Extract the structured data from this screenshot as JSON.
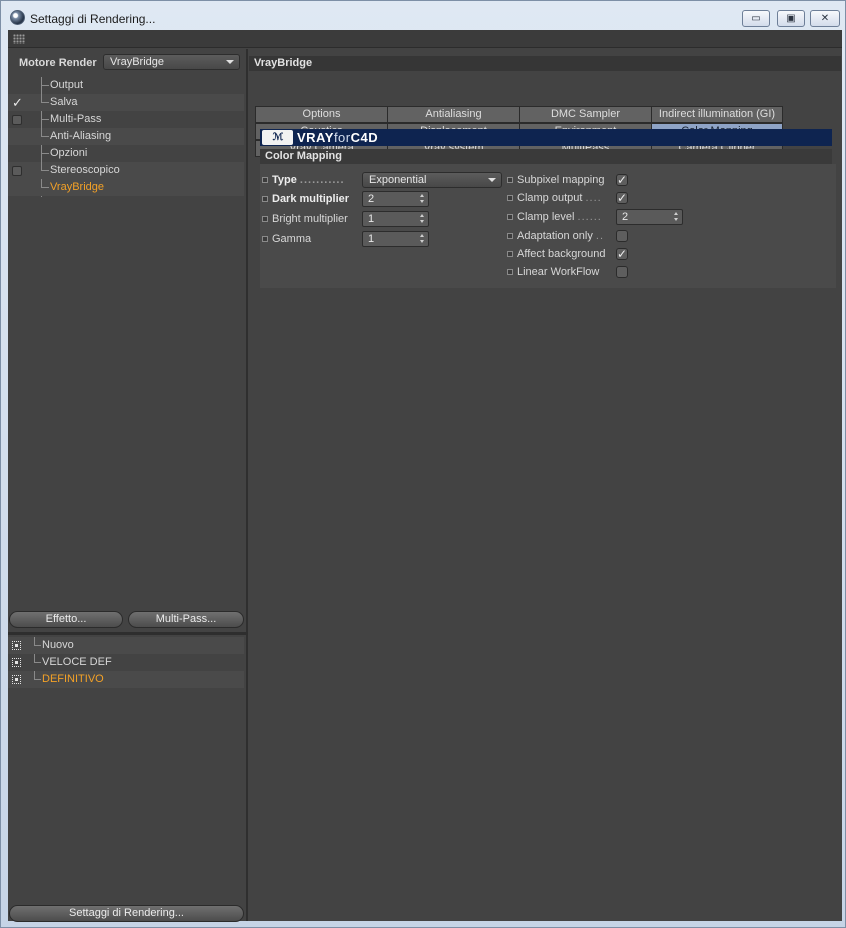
{
  "window": {
    "title": "Settaggi di Rendering...",
    "controls": {
      "minimize": "▭",
      "maximize": "▣",
      "close": "✕"
    }
  },
  "left": {
    "engine_label": "Motore Render",
    "engine_value": "VrayBridge",
    "tree": [
      {
        "label": "Output",
        "checked": null,
        "selected": false
      },
      {
        "label": "Salva",
        "checked": true,
        "selected": false
      },
      {
        "label": "Multi-Pass",
        "checked": false,
        "selected": false
      },
      {
        "label": "Anti-Aliasing",
        "checked": null,
        "selected": false
      },
      {
        "label": "Opzioni",
        "checked": null,
        "selected": false
      },
      {
        "label": "Stereoscopico",
        "checked": false,
        "selected": false
      },
      {
        "label": "VrayBridge",
        "checked": null,
        "selected": true
      }
    ],
    "effect_button": "Effetto...",
    "multipass_button": "Multi-Pass...",
    "presets": [
      {
        "label": "Nuovo",
        "selected": false
      },
      {
        "label": "VELOCE DEF",
        "selected": false
      },
      {
        "label": "DEFINITIVO",
        "selected": true
      }
    ],
    "settings_button": "Settaggi di Rendering..."
  },
  "right": {
    "header": "VrayBridge",
    "tabs_row1": [
      "Options",
      "Antialiasing",
      "DMC Sampler",
      "Indirect illumination (GI)"
    ],
    "tabs_row2": [
      "Caustics",
      "Displacement",
      "Environment",
      "Color Mapping"
    ],
    "tabs_row3": [
      "Vray Camera",
      "Vray system",
      "MultiPass",
      "Camera Clipper"
    ],
    "active_tab": "Color Mapping",
    "banner_logo_mark": "ℳ",
    "banner_text_main": "VRAY",
    "banner_text_for": "for",
    "banner_text_c4d": "C4D",
    "section_title": "Color Mapping",
    "type_label": "Type",
    "type_dots": "...........",
    "type_value": "Exponential",
    "dark_label": "Dark multiplier",
    "dark_value": "2",
    "bright_label": "Bright multiplier",
    "bright_value": "1",
    "gamma_label": "Gamma",
    "gamma_value": "1",
    "subpixel_label": "Subpixel mapping",
    "subpixel_checked": true,
    "clamp_output_label": "Clamp output",
    "clamp_output_dots": "....",
    "clamp_output_checked": true,
    "clamp_level_label": "Clamp level",
    "clamp_level_dots": "......",
    "clamp_level_value": "2",
    "adaptation_label": "Adaptation only",
    "adaptation_dots": "..",
    "adaptation_checked": false,
    "affect_bg_label": "Affect background",
    "affect_bg_checked": true,
    "linear_label": "Linear WorkFlow",
    "linear_checked": false
  },
  "colors": {
    "background": "#434343",
    "selected_text": "#f3a127",
    "active_tab": "#8ea3c6",
    "banner": "#0e2450"
  }
}
